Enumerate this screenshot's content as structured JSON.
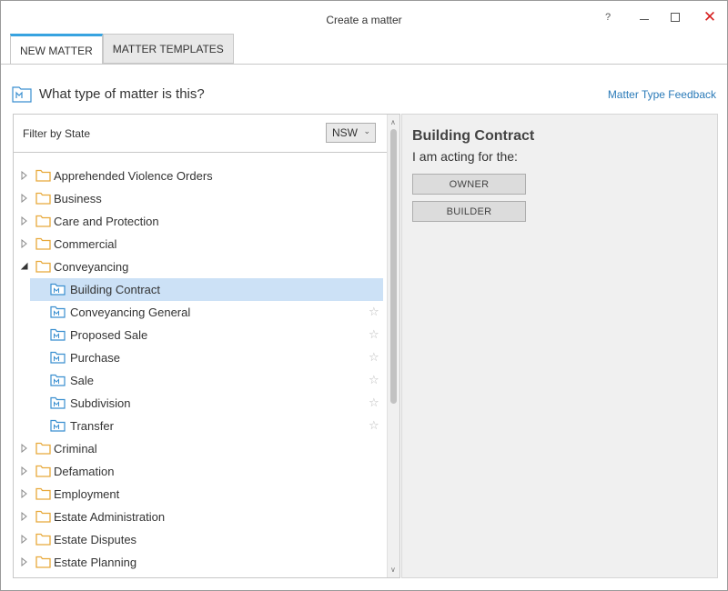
{
  "window": {
    "title": "Create a matter",
    "help_label": "?",
    "close_label": "✕"
  },
  "tabs": [
    {
      "label": "NEW MATTER",
      "active": true
    },
    {
      "label": "MATTER TEMPLATES",
      "active": false
    }
  ],
  "header": {
    "question": "What type of matter is this?",
    "feedback_link": "Matter Type Feedback"
  },
  "filter": {
    "label": "Filter by State",
    "selected_state": "NSW"
  },
  "tree": {
    "before": [
      {
        "label": "Apprehended Violence Orders"
      },
      {
        "label": "Business"
      },
      {
        "label": "Care and Protection"
      },
      {
        "label": "Commercial"
      }
    ],
    "expanded": {
      "label": "Conveyancing",
      "children": [
        {
          "label": "Building Contract",
          "selected": true
        },
        {
          "label": "Conveyancing General"
        },
        {
          "label": "Proposed Sale"
        },
        {
          "label": "Purchase"
        },
        {
          "label": "Sale"
        },
        {
          "label": "Subdivision"
        },
        {
          "label": "Transfer"
        }
      ]
    },
    "after": [
      {
        "label": "Criminal"
      },
      {
        "label": "Defamation"
      },
      {
        "label": "Employment"
      },
      {
        "label": "Estate Administration"
      },
      {
        "label": "Estate Disputes"
      },
      {
        "label": "Estate Planning"
      }
    ]
  },
  "detail": {
    "title": "Building Contract",
    "subtitle": "I am acting for the:",
    "roles": [
      "OWNER",
      "BUILDER"
    ]
  },
  "colors": {
    "accent": "#37a3e0",
    "selection": "#cce1f6",
    "folder": "#e8a93a",
    "matter_icon": "#3a8fd0",
    "close": "#d61f1f",
    "link": "#2a7ab8"
  }
}
